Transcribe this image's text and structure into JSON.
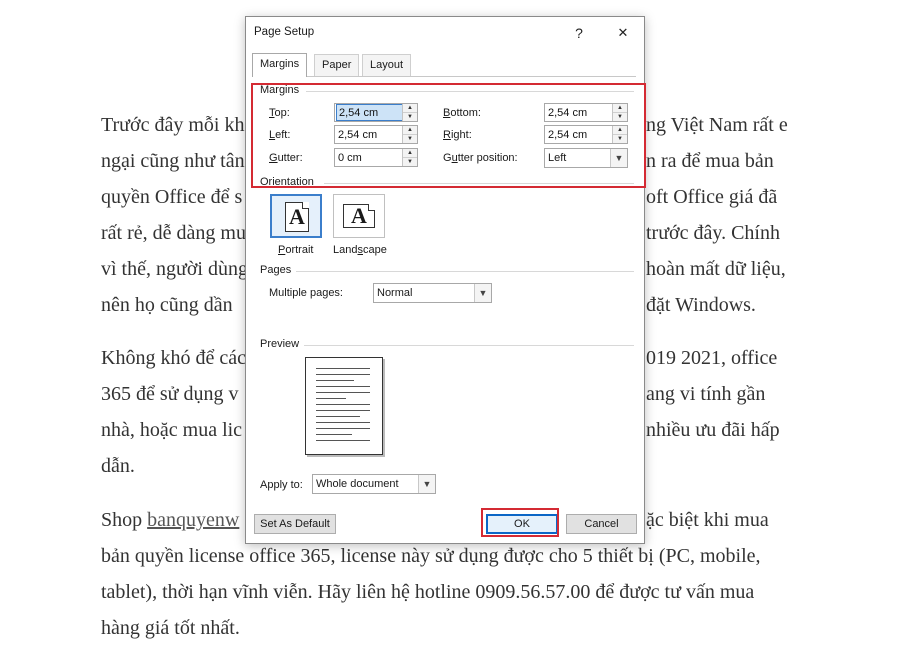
{
  "article": {
    "lines": [
      "Trước đây mỗi kh",
      "ng Việt Nam rất e",
      "ngại cũng như tân",
      "n ra để mua bản",
      "quyền Office để s",
      "oft Office giá đã",
      "rất rẻ, dễ dàng mu",
      "trước đây. Chính",
      "vì thế, người dùng",
      "hoàn mất dữ liệu,",
      "nên họ cũng dần",
      "đặt Windows.",
      "Không khó để các",
      "019 2021, office",
      "365 để sử dụng v",
      "ang vi tính gần",
      "nhà, hoặc mua lic",
      "nhiều ưu đãi  hấp",
      "dẫn.",
      "Shop ",
      "banquyenw",
      "ặc biệt khi mua",
      "bản quyền license office 365, license này sử dụng được cho 5 thiết bị (PC, mobile,",
      "tablet), thời hạn vĩnh viễn. Hãy liên hệ hotline 0909.56.57.00 để được tư vấn mua",
      "hàng giá tốt nhất."
    ]
  },
  "dialog": {
    "title": "Page Setup",
    "help": "?",
    "close": "✕",
    "tabs": [
      "Margins",
      "Paper",
      "Layout"
    ],
    "margins_section": "Margins",
    "top_label_u": "T",
    "top_label_rest": "op:",
    "top_value": "2,54 cm",
    "bottom_label_u": "B",
    "bottom_label_rest": "ottom:",
    "bottom_value": "2,54 cm",
    "left_label_u": "L",
    "left_label_rest": "eft:",
    "left_value": "2,54 cm",
    "right_label_u": "R",
    "right_label_rest": "ight:",
    "right_value": "2,54 cm",
    "gutter_label_u": "G",
    "gutter_label_rest": "utter:",
    "gutter_value": "0 cm",
    "gutter_pos_label_pre": "G",
    "gutter_pos_label_u": "u",
    "gutter_pos_label_rest": "tter position:",
    "gutter_pos_value": "Left",
    "orientation_section": "Orientation",
    "portrait_u": "P",
    "portrait_rest": "ortrait",
    "landscape_pre": "Land",
    "landscape_u": "s",
    "landscape_rest": "cape",
    "pages_section": "Pages",
    "multiple_pre": "Multiple pages:",
    "multiple_value": "Normal",
    "preview_section": "Preview",
    "apply_label": "Apply to:",
    "apply_value": "Whole document",
    "default_btn": "Set As Default",
    "ok_btn": "OK",
    "cancel_btn": "Cancel",
    "orient_glyph": "A"
  }
}
